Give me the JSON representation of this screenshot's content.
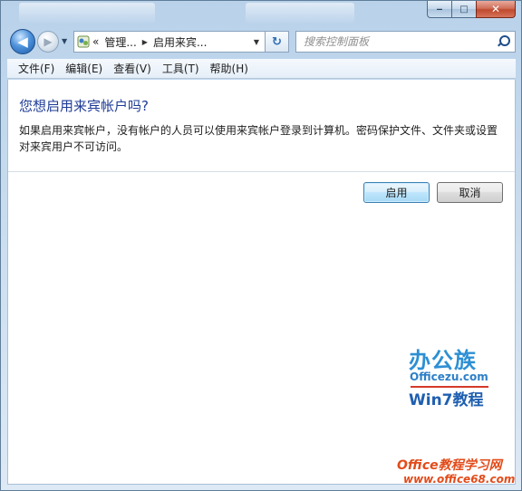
{
  "window": {
    "min_glyph": "‒",
    "max_glyph": "□",
    "close_glyph": "✕"
  },
  "nav": {
    "back_glyph": "◀",
    "forward_glyph": "▶",
    "dropdown_glyph": "▼",
    "refresh_glyph": "↻"
  },
  "address": {
    "overflow": "«",
    "crumbs": [
      "管理...",
      "启用来宾..."
    ],
    "separator": "▶",
    "dropdown": "▼"
  },
  "search": {
    "placeholder": "搜索控制面板"
  },
  "menubar": {
    "items": [
      "文件(F)",
      "编辑(E)",
      "查看(V)",
      "工具(T)",
      "帮助(H)"
    ]
  },
  "dialog": {
    "heading": "您想启用来宾帐户吗?",
    "description": "如果启用来宾帐户，没有帐户的人员可以使用来宾帐户登录到计算机。密码保护文件、文件夹或设置对来宾用户不可访问。",
    "enable_label": "启用",
    "cancel_label": "取消"
  },
  "watermark": {
    "brand": "办公族",
    "domain": "Officezu.com",
    "course": "Win7教程",
    "site_title": "Office教程学习网",
    "site_url": "www.office68.com"
  },
  "icons": {
    "address_icon": "control-panel-icon",
    "search_icon": "search-icon"
  },
  "colors": {
    "heading": "#1e3b96",
    "watermark_blue": "#2d8fd4",
    "watermark_orange": "#e24b1a"
  }
}
